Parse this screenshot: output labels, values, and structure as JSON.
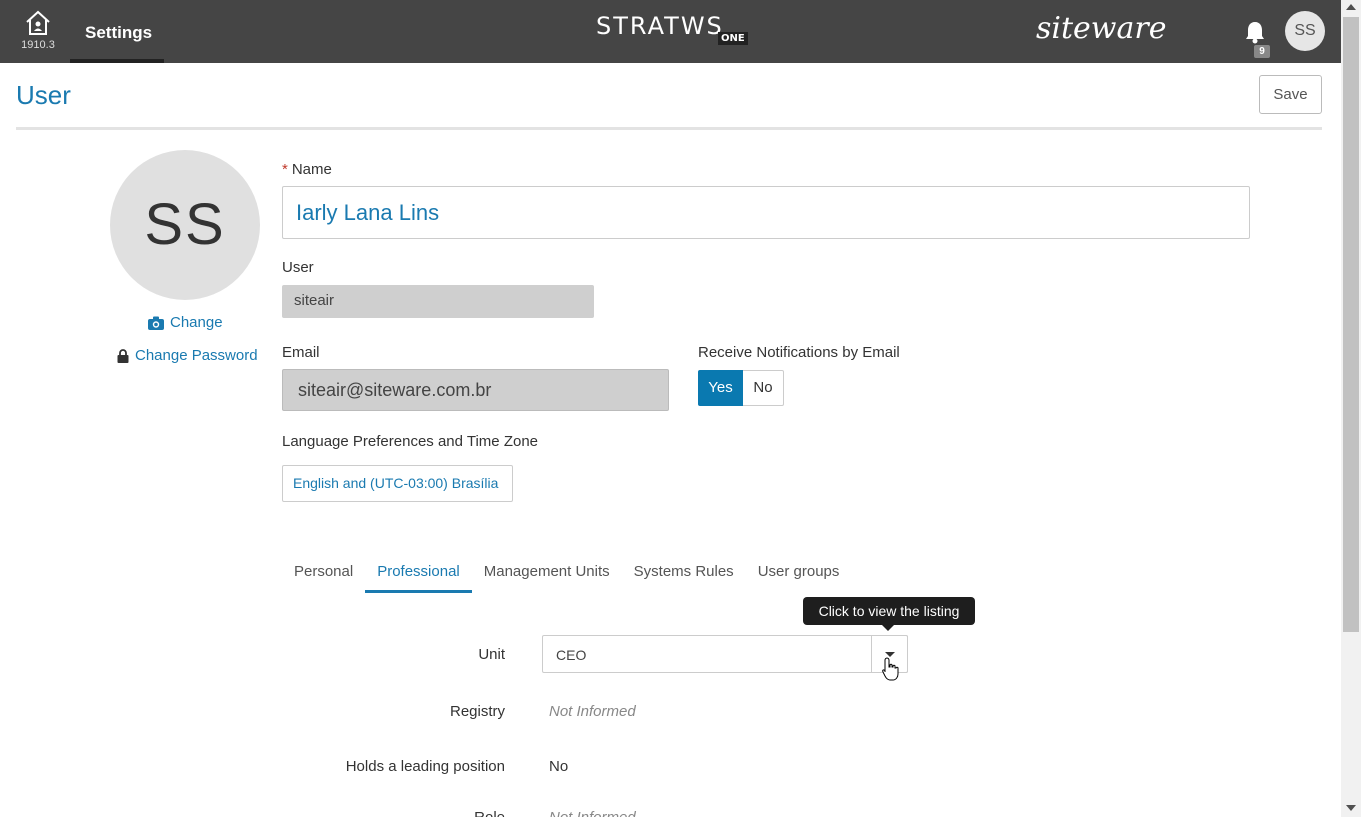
{
  "topbar": {
    "version": "1910.3",
    "active_tab": "Settings",
    "brand": "STRATWS",
    "brand_suffix": "ONE",
    "vendor": "siteware",
    "notification_count": "9",
    "user_initials": "SS"
  },
  "page": {
    "title": "User",
    "save_label": "Save"
  },
  "profile": {
    "initials": "SS",
    "change_photo_label": "Change",
    "change_password_label": "Change Password"
  },
  "form": {
    "required_mark": "*",
    "name_label": "Name",
    "name_value": "Iarly Lana Lins",
    "user_label": "User",
    "user_value": "siteair",
    "email_label": "Email",
    "email_value": "siteair@siteware.com.br",
    "notifications_label": "Receive Notifications by Email",
    "notifications_yes": "Yes",
    "notifications_no": "No",
    "notifications_selected": "Yes",
    "language_label": "Language Preferences and Time Zone",
    "language_value": "English and (UTC-03:00) Brasília"
  },
  "tabs": [
    {
      "label": "Personal",
      "active": false
    },
    {
      "label": "Professional",
      "active": true
    },
    {
      "label": "Management Units",
      "active": false
    },
    {
      "label": "Systems Rules",
      "active": false
    },
    {
      "label": "User groups",
      "active": false
    }
  ],
  "professional": {
    "tooltip": "Click to view the listing",
    "unit_label": "Unit",
    "unit_value": "CEO",
    "registry_label": "Registry",
    "registry_value": "Not Informed",
    "leading_label": "Holds a leading position",
    "leading_value": "No",
    "role_label": "Role",
    "role_value": "Not Informed"
  },
  "colors": {
    "accent": "#1a7ab0",
    "topbar": "#454545",
    "toggle_active": "#0a79b0"
  }
}
